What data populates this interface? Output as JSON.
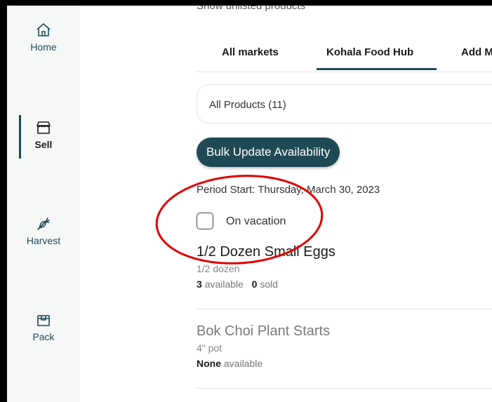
{
  "sidebar": {
    "items": [
      {
        "label": "Home",
        "icon": "home-icon",
        "active": false
      },
      {
        "label": "Sell",
        "icon": "storefront-icon",
        "active": true
      },
      {
        "label": "Harvest",
        "icon": "carrot-icon",
        "active": false
      },
      {
        "label": "Pack",
        "icon": "box-icon",
        "active": false
      }
    ]
  },
  "main": {
    "cut_off_text": "Show unlisted products",
    "tabs": [
      {
        "label": "All markets"
      },
      {
        "label": "Kohala Food Hub",
        "active": true
      },
      {
        "label": "Add M"
      }
    ],
    "product_filter": "All Products (11)",
    "bulk_button": "Bulk Update Availability",
    "period_start": "Period Start: Thursday, March 30, 2023",
    "vacation_label": "On vacation",
    "vacation_checked": false,
    "products": [
      {
        "name": "1/2 Dozen Small Eggs",
        "unit": "1/2 dozen",
        "available": "3",
        "available_word": "available",
        "sold": "0",
        "sold_word": "sold"
      },
      {
        "name": "Bok Choi Plant Starts",
        "unit": "4\" pot",
        "available": "None",
        "available_word": "available"
      }
    ]
  },
  "colors": {
    "accent": "#1f4a55",
    "annotation": "#e00000",
    "sidebar_bg": "#f6f7f7"
  }
}
